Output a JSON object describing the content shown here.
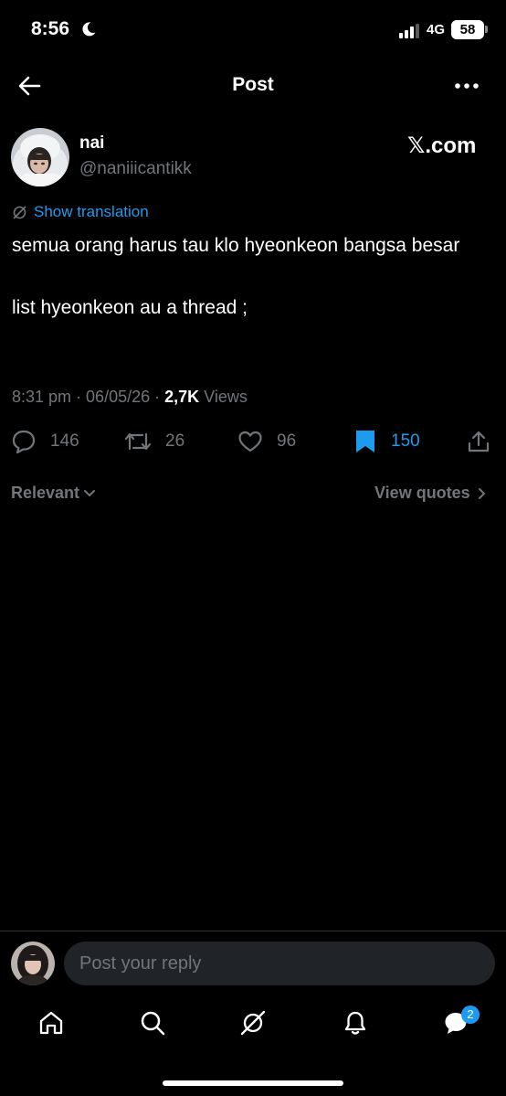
{
  "status_bar": {
    "time": "8:56",
    "network": "4G",
    "battery": "58"
  },
  "header": {
    "title": "Post",
    "back_icon": "arrow-left-icon",
    "more_icon": "more-horizontal-icon"
  },
  "author": {
    "name": "nai",
    "handle": "@naniiicantikk",
    "watermark": "𝕏.com"
  },
  "translation": {
    "label": "Show translation"
  },
  "post": {
    "lines": [
      "semua orang harus tau klo hyeonkeon bangsa besar",
      "",
      "list hyeonkeon au a thread ;"
    ],
    "time": "8:31 pm",
    "date": "06/05/26",
    "views_count": "2,7K",
    "views_label": "Views"
  },
  "actions": {
    "replies": "146",
    "reposts": "26",
    "likes": "96",
    "bookmarks": "150"
  },
  "filters": {
    "sort": "Relevant",
    "quotes": "View quotes"
  },
  "reply": {
    "placeholder": "Post your reply"
  },
  "tabbar": {
    "messages_badge": "2"
  },
  "colors": {
    "accent": "#1d9bf0",
    "background": "#000000",
    "muted": "#71767b"
  }
}
